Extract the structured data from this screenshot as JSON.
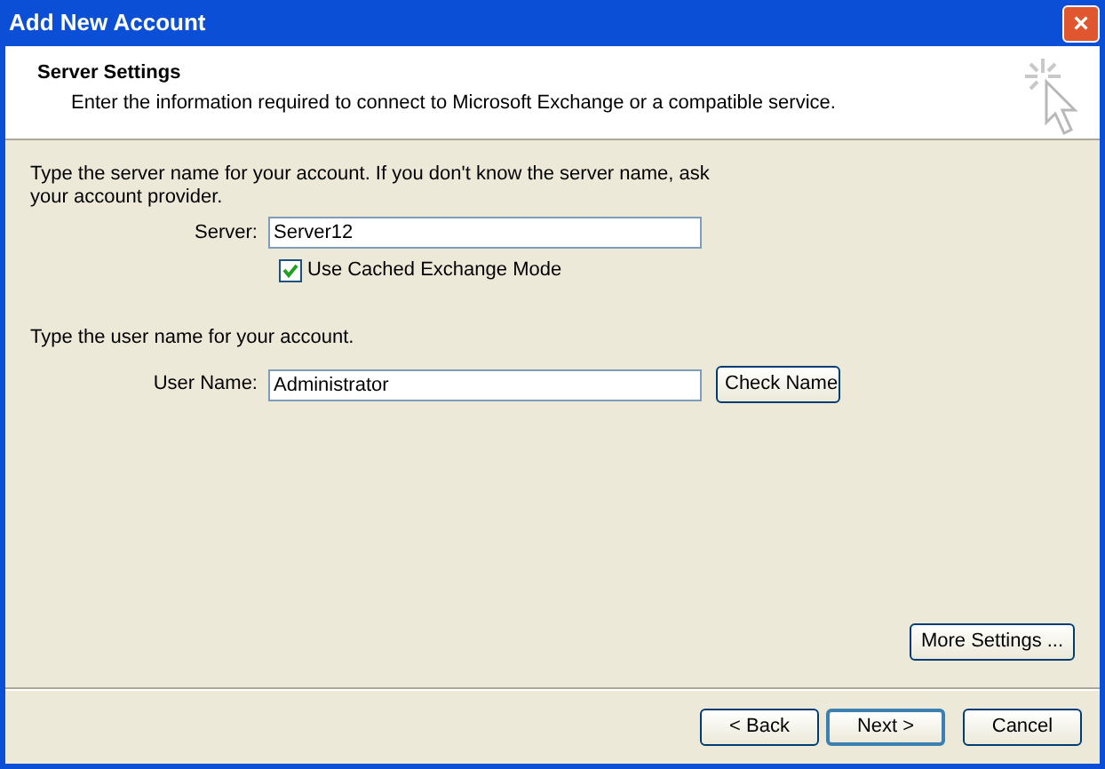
{
  "window": {
    "title": "Add New Account",
    "close": "×"
  },
  "header": {
    "title": "Server Settings",
    "subtitle": "Enter the information required to connect to Microsoft Exchange or a compatible service."
  },
  "server_section": {
    "instruction": "Type the server name for your account. If you don't know the server name, ask your account provider.",
    "label": "Server:",
    "value": "Server12",
    "checkbox": {
      "label": "Use Cached Exchange Mode",
      "checked": true
    }
  },
  "user_section": {
    "instruction": "Type the user name for your account.",
    "label": "User Name:",
    "value": "Administrator",
    "button": "Check Name"
  },
  "more_settings": "More Settings ...",
  "buttons": [
    {
      "label": "< Back",
      "default": false
    },
    {
      "label": "Next >",
      "default": true
    },
    {
      "label": "Cancel",
      "default": false
    }
  ]
}
